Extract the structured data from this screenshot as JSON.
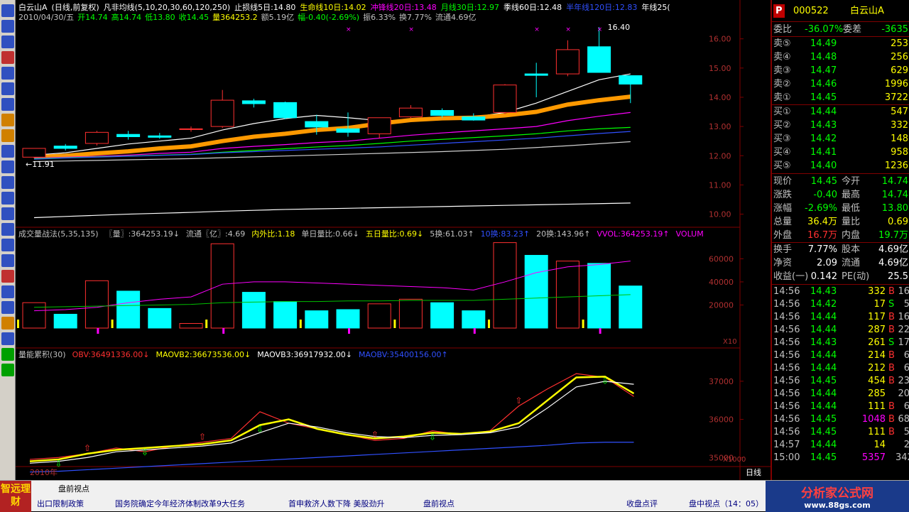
{
  "header": {
    "line1": [
      {
        "t": "白云山A",
        "c": "#ffffff"
      },
      {
        "t": "(日线,前复权)",
        "c": "#ffffff"
      },
      {
        "t": "凡非均线(5,10,20,30,60,120,250)",
        "c": "#ffffff"
      },
      {
        "t": "止损线5日:14.80",
        "c": "#ffffff"
      },
      {
        "t": "生命线10日:14.02",
        "c": "#ffff00"
      },
      {
        "t": "冲锋线20日:13.48",
        "c": "#ff00ff"
      },
      {
        "t": "月线30日:12.97",
        "c": "#00ff00"
      },
      {
        "t": "季线60日:12.48",
        "c": "#ffffff"
      },
      {
        "t": "半年线120日:12.83",
        "c": "#3050ff"
      },
      {
        "t": "年线25(",
        "c": "#ffffff"
      }
    ],
    "line2": [
      {
        "t": "2010/04/30/五",
        "c": "#c0c0c0"
      },
      {
        "t": "开14.74",
        "c": "#00ff00"
      },
      {
        "t": "高14.74",
        "c": "#00ff00"
      },
      {
        "t": "低13.80",
        "c": "#00ff00"
      },
      {
        "t": "收14.45",
        "c": "#00ff00"
      },
      {
        "t": "量364253.2",
        "c": "#ffff00"
      },
      {
        "t": "额5.19亿",
        "c": "#c0c0c0"
      },
      {
        "t": "幅-0.40(-2.69%)",
        "c": "#00ff00"
      },
      {
        "t": "振6.33%",
        "c": "#c0c0c0"
      },
      {
        "t": "换7.77%",
        "c": "#c0c0c0"
      },
      {
        "t": "流通4.69亿",
        "c": "#c0c0c0"
      }
    ]
  },
  "vol_header": [
    {
      "t": "成交量战法(5,35,135)",
      "c": "#c0c0c0"
    },
    {
      "t": "〖量〗:364253.19↓",
      "c": "#c0c0c0"
    },
    {
      "t": "流通〖亿〗:4.69",
      "c": "#c0c0c0"
    },
    {
      "t": "内外比:1.18",
      "c": "#ffff00"
    },
    {
      "t": "单日量比:0.66↓",
      "c": "#c0c0c0"
    },
    {
      "t": "五日量比:0.69↓",
      "c": "#ffff00"
    },
    {
      "t": "5换:61.03↑",
      "c": "#c0c0c0"
    },
    {
      "t": "10换:83.23↑",
      "c": "#3050ff"
    },
    {
      "t": "20换:143.96↑",
      "c": "#c0c0c0"
    },
    {
      "t": "VVOL:364253.19↑",
      "c": "#ff00ff"
    },
    {
      "t": "VOLUM",
      "c": "#ff00ff"
    }
  ],
  "obv_header": [
    {
      "t": "量能累积(30)",
      "c": "#c0c0c0"
    },
    {
      "t": "OBV:36491336.00↓",
      "c": "#ff3030"
    },
    {
      "t": "MAOVB2:36673536.00↓",
      "c": "#ffff00"
    },
    {
      "t": "MAOVB3:36917932.00↓",
      "c": "#ffffff"
    },
    {
      "t": "MAOBV:35400156.00↑",
      "c": "#3050ff"
    }
  ],
  "annotations": {
    "high_label": "16.40",
    "low_label": "←11.91",
    "vol_scale": "X10",
    "obv_scale": "X1000",
    "year_label": "2010年",
    "period_tab": "日线"
  },
  "chart_data": [
    {
      "type": "candlestick",
      "title": "白云山A 日线",
      "ylim": [
        9.6,
        16.6
      ],
      "y_ticks": [
        "16.00",
        "15.00",
        "14.00",
        "13.00",
        "12.00",
        "11.00",
        "10.00"
      ],
      "candles": [
        {
          "o": 11.95,
          "h": 12.25,
          "l": 11.91,
          "c": 12.25
        },
        {
          "o": 12.33,
          "h": 12.4,
          "l": 12.18,
          "c": 12.25
        },
        {
          "o": 12.42,
          "h": 12.85,
          "l": 12.35,
          "c": 12.8
        },
        {
          "o": 12.73,
          "h": 12.85,
          "l": 12.55,
          "c": 12.65
        },
        {
          "o": 12.68,
          "h": 12.78,
          "l": 12.58,
          "c": 12.63
        },
        {
          "o": 12.9,
          "h": 13.0,
          "l": 12.82,
          "c": 12.92
        },
        {
          "o": 13.0,
          "h": 14.25,
          "l": 12.95,
          "c": 13.9
        },
        {
          "o": 13.88,
          "h": 13.95,
          "l": 13.65,
          "c": 13.78
        },
        {
          "o": 13.82,
          "h": 13.85,
          "l": 13.25,
          "c": 13.3
        },
        {
          "o": 13.17,
          "h": 13.4,
          "l": 12.72,
          "c": 12.98
        },
        {
          "o": 12.92,
          "h": 13.48,
          "l": 12.65,
          "c": 12.8
        },
        {
          "o": 12.75,
          "h": 13.25,
          "l": 12.6,
          "c": 13.3
        },
        {
          "o": 13.33,
          "h": 13.73,
          "l": 13.28,
          "c": 13.63
        },
        {
          "o": 13.55,
          "h": 13.62,
          "l": 13.3,
          "c": 13.38
        },
        {
          "o": 13.33,
          "h": 13.45,
          "l": 13.2,
          "c": 13.22
        },
        {
          "o": 13.48,
          "h": 14.45,
          "l": 13.42,
          "c": 14.42
        },
        {
          "o": 14.8,
          "h": 15.18,
          "l": 14.0,
          "c": 14.75
        },
        {
          "o": 14.8,
          "h": 15.95,
          "l": 14.72,
          "c": 15.63
        },
        {
          "o": 15.73,
          "h": 16.4,
          "l": 14.9,
          "c": 14.85
        },
        {
          "o": 14.74,
          "h": 14.74,
          "l": 13.8,
          "c": 14.45
        }
      ],
      "ma": [
        {
          "name": "MA5",
          "color": "#ffffff",
          "values": [
            12.02,
            12.1,
            12.25,
            12.4,
            12.5,
            12.6,
            12.88,
            13.1,
            13.27,
            13.38,
            13.3,
            13.2,
            13.2,
            13.3,
            13.32,
            13.48,
            13.8,
            14.2,
            14.6,
            14.8
          ]
        },
        {
          "name": "MA10",
          "color": "#ff9900",
          "values": [
            11.95,
            12.0,
            12.08,
            12.15,
            12.25,
            12.32,
            12.5,
            12.65,
            12.75,
            12.88,
            12.95,
            13.1,
            13.22,
            13.28,
            13.3,
            13.38,
            13.5,
            13.75,
            13.9,
            14.02
          ]
        },
        {
          "name": "MA20",
          "color": "#ff00ff",
          "values": [
            11.92,
            11.95,
            11.98,
            12.02,
            12.08,
            12.12,
            12.25,
            12.32,
            12.38,
            12.45,
            12.5,
            12.6,
            12.7,
            12.78,
            12.85,
            12.92,
            13.0,
            13.2,
            13.35,
            13.48
          ]
        },
        {
          "name": "MA30",
          "color": "#00ff00",
          "values": [
            11.9,
            11.93,
            11.96,
            11.99,
            12.02,
            12.05,
            12.12,
            12.18,
            12.24,
            12.3,
            12.35,
            12.42,
            12.5,
            12.56,
            12.62,
            12.68,
            12.75,
            12.85,
            12.92,
            12.97
          ]
        },
        {
          "name": "MA60",
          "color": "#3050ff",
          "values": [
            11.88,
            11.92,
            11.95,
            11.98,
            12.01,
            12.04,
            12.1,
            12.14,
            12.18,
            12.22,
            12.26,
            12.3,
            12.36,
            12.42,
            12.48,
            12.54,
            12.6,
            12.68,
            12.76,
            12.83
          ]
        },
        {
          "name": "MA120",
          "color": "#d0d0d0",
          "values": [
            11.8,
            11.82,
            11.84,
            11.86,
            11.88,
            11.9,
            11.93,
            11.96,
            11.99,
            12.02,
            12.05,
            12.08,
            12.11,
            12.14,
            12.18,
            12.22,
            12.28,
            12.34,
            12.41,
            12.48
          ]
        },
        {
          "name": "MA250",
          "color": "#ffffff",
          "values": [
            9.88,
            9.92,
            9.96,
            10.0,
            10.03,
            10.06,
            10.1,
            10.13,
            10.16,
            10.18,
            10.2,
            10.22,
            10.24,
            10.26,
            10.28,
            10.3,
            10.32,
            10.34,
            10.36,
            10.38
          ]
        }
      ]
    },
    {
      "type": "bar",
      "title": "成交量战法",
      "ylim": [
        0,
        75000
      ],
      "y_ticks": [
        "60000",
        "40000",
        "20000"
      ],
      "values": [
        22000,
        12000,
        41000,
        32000,
        17000,
        4000,
        73000,
        31000,
        23000,
        15000,
        16000,
        21000,
        25000,
        22000,
        15000,
        74000,
        63000,
        58000,
        56000,
        36453
      ]
    },
    {
      "type": "line",
      "title": "量能累积",
      "ylim": [
        34800,
        37500
      ],
      "y_ticks": [
        "37000",
        "36000",
        "35000"
      ],
      "series": [
        {
          "name": "OBV",
          "color": "#ff3030",
          "values": [
            34950,
            35000,
            35100,
            35250,
            35150,
            35300,
            35400,
            35500,
            36200,
            35900,
            35750,
            35600,
            35450,
            35500,
            35700,
            35600,
            35700,
            36350,
            36800,
            37200,
            37100,
            36600
          ]
        },
        {
          "name": "MAOVB2",
          "color": "#ffff00",
          "values": [
            34900,
            34950,
            35100,
            35200,
            35250,
            35300,
            35350,
            35450,
            35850,
            36000,
            35750,
            35600,
            35500,
            35550,
            35650,
            35620,
            35680,
            35900,
            36500,
            37100,
            37120,
            36680
          ]
        },
        {
          "name": "MAOVB3",
          "color": "#ffffff",
          "values": [
            34850,
            34900,
            35000,
            35150,
            35200,
            35250,
            35300,
            35380,
            35650,
            35900,
            35800,
            35650,
            35550,
            35520,
            35580,
            35600,
            35650,
            35800,
            36300,
            36850,
            37000,
            36920
          ]
        },
        {
          "name": "MAOBV",
          "color": "#3050ff",
          "values": [
            34620,
            34640,
            34680,
            34720,
            34760,
            34800,
            34840,
            34880,
            34920,
            34960,
            35000,
            35040,
            35080,
            35120,
            35160,
            35200,
            35240,
            35280,
            35320,
            35380,
            35400,
            35400
          ]
        }
      ]
    }
  ],
  "quote": {
    "code": "000522",
    "name": "白云山A",
    "weibi_label": "委比",
    "weibi": "-36.07%",
    "weicha_label": "委差",
    "weicha": "-3635",
    "sells": [
      {
        "l": "卖⑤",
        "p": "14.49",
        "v": "253"
      },
      {
        "l": "卖④",
        "p": "14.48",
        "v": "256"
      },
      {
        "l": "卖③",
        "p": "14.47",
        "v": "629"
      },
      {
        "l": "卖②",
        "p": "14.46",
        "v": "1996"
      },
      {
        "l": "卖①",
        "p": "14.45",
        "v": "3722"
      }
    ],
    "buys": [
      {
        "l": "买①",
        "p": "14.44",
        "v": "547"
      },
      {
        "l": "买②",
        "p": "14.43",
        "v": "332"
      },
      {
        "l": "买③",
        "p": "14.42",
        "v": "148"
      },
      {
        "l": "买④",
        "p": "14.41",
        "v": "958"
      },
      {
        "l": "买⑤",
        "p": "14.40",
        "v": "1236"
      }
    ],
    "stats": [
      {
        "l1": "现价",
        "v1": "14.45",
        "c1": "#00ff00",
        "l2": "今开",
        "v2": "14.74",
        "c2": "#00ff00"
      },
      {
        "l1": "涨跌",
        "v1": "-0.40",
        "c1": "#00ff00",
        "l2": "最高",
        "v2": "14.74",
        "c2": "#00ff00"
      },
      {
        "l1": "涨幅",
        "v1": "-2.69%",
        "c1": "#00ff00",
        "l2": "最低",
        "v2": "13.80",
        "c2": "#00ff00"
      },
      {
        "l1": "总量",
        "v1": "36.4万",
        "c1": "#ffff00",
        "l2": "量比",
        "v2": "0.69",
        "c2": "#ffff00"
      },
      {
        "l1": "外盘",
        "v1": "16.7万",
        "c1": "#ff3030",
        "l2": "内盘",
        "v2": "19.7万",
        "c2": "#00ff00"
      }
    ],
    "stats2": [
      {
        "l1": "换手",
        "v1": "7.77%",
        "l2": "股本",
        "v2": "4.69亿"
      },
      {
        "l1": "净资",
        "v1": "2.09",
        "l2": "流通",
        "v2": "4.69亿"
      },
      {
        "l1": "收益(一)",
        "v1": "0.142",
        "l2": "PE(动)",
        "v2": "25.5"
      }
    ],
    "ticks": [
      {
        "t": "14:56",
        "p": "14.43",
        "v": "332",
        "bs": "B",
        "n": "16",
        "vc": "#ffff00"
      },
      {
        "t": "14:56",
        "p": "14.42",
        "v": "17",
        "bs": "S",
        "n": "5",
        "vc": "#ffff00"
      },
      {
        "t": "14:56",
        "p": "14.44",
        "v": "117",
        "bs": "B",
        "n": "16",
        "vc": "#ffff00"
      },
      {
        "t": "14:56",
        "p": "14.44",
        "v": "287",
        "bs": "B",
        "n": "22",
        "vc": "#ffff00"
      },
      {
        "t": "14:56",
        "p": "14.43",
        "v": "261",
        "bs": "S",
        "n": "17",
        "vc": "#ffff00"
      },
      {
        "t": "14:56",
        "p": "14.44",
        "v": "214",
        "bs": "B",
        "n": "6",
        "vc": "#ffff00"
      },
      {
        "t": "14:56",
        "p": "14.44",
        "v": "212",
        "bs": "B",
        "n": "6",
        "vc": "#ffff00"
      },
      {
        "t": "14:56",
        "p": "14.45",
        "v": "454",
        "bs": "B",
        "n": "23",
        "vc": "#ffff00"
      },
      {
        "t": "14:56",
        "p": "14.44",
        "v": "285",
        "bs": "",
        "n": "20",
        "vc": "#ffff00"
      },
      {
        "t": "14:56",
        "p": "14.44",
        "v": "111",
        "bs": "B",
        "n": "6",
        "vc": "#ffff00"
      },
      {
        "t": "14:56",
        "p": "14.45",
        "v": "1048",
        "bs": "B",
        "n": "68",
        "vc": "#ff00ff"
      },
      {
        "t": "14:56",
        "p": "14.45",
        "v": "111",
        "bs": "B",
        "n": "5",
        "vc": "#ffff00"
      },
      {
        "t": "14:57",
        "p": "14.44",
        "v": "14",
        "bs": "",
        "n": "2",
        "vc": "#ffff00"
      },
      {
        "t": "15:00",
        "p": "14.45",
        "v": "5357",
        "bs": "",
        "n": "342",
        "vc": "#ff00ff"
      }
    ]
  },
  "bottom": {
    "logo": "智远理财",
    "row1": "盘前视点",
    "news": [
      "出口限制政策",
      "国务院确定今年经济体制改革9大任务",
      "首申救济人数下降 美股劲升",
      "盘前视点",
      "收盘点评",
      "盘中视点（14：05）"
    ],
    "site": "分析家公式网",
    "site_url": "www.88gs.com"
  }
}
